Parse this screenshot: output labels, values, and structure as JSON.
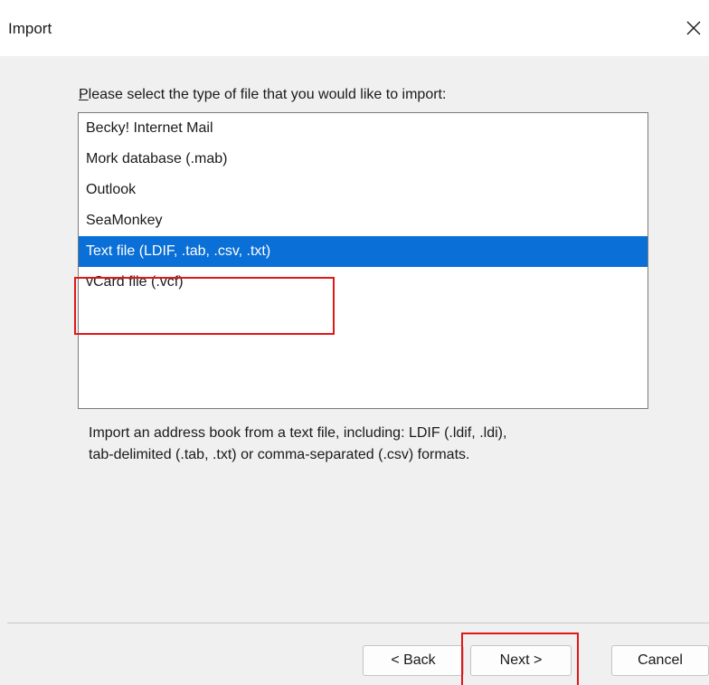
{
  "window": {
    "title": "Import"
  },
  "prompt": {
    "accelerator": "P",
    "rest": "lease select the type of file that you would like to import:"
  },
  "file_types": [
    {
      "label": "Becky! Internet Mail",
      "selected": false
    },
    {
      "label": "Mork database (.mab)",
      "selected": false
    },
    {
      "label": "Outlook",
      "selected": false
    },
    {
      "label": "SeaMonkey",
      "selected": false
    },
    {
      "label": "Text file (LDIF, .tab, .csv, .txt)",
      "selected": true
    },
    {
      "label": "vCard file (.vcf)",
      "selected": false
    }
  ],
  "description": {
    "line1": "Import an address book from a text file, including: LDIF (.ldif, .ldi),",
    "line2": "tab-delimited (.tab, .txt) or comma-separated (.csv) formats."
  },
  "buttons": {
    "back": "< Back",
    "next": "Next >",
    "cancel": "Cancel"
  },
  "colors": {
    "selection": "#0a6fd6",
    "annotation": "#e01818"
  },
  "icons": {
    "close": "close-icon"
  }
}
